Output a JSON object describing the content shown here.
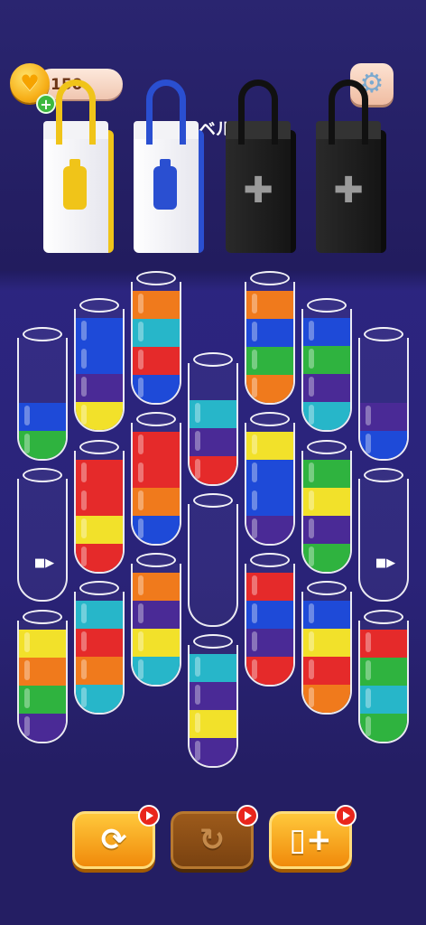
{
  "header": {
    "coins": "150",
    "level_label": "レベル4"
  },
  "bags": [
    {
      "color": "#f0c419",
      "state": "open"
    },
    {
      "color": "#2a4fd1",
      "state": "open"
    },
    {
      "color": "#1a1a1a",
      "state": "locked"
    },
    {
      "color": "#1a1a1a",
      "state": "locked"
    }
  ],
  "tubes": [
    {
      "layers": [
        "#2fb33f",
        "#1e4ad8"
      ]
    },
    {
      "layers": [
        "#f2e12a",
        "#4a2a96",
        "#1e4ad8",
        "#1e4ad8"
      ]
    },
    {
      "layers": [
        "#1e4ad8",
        "#e52a2a",
        "#27b6c9",
        "#f07a1c"
      ]
    },
    {
      "layers": [
        "#e52a2a",
        "#4a2a96",
        "#27b6c9"
      ]
    },
    {
      "layers": [
        "#f07a1c",
        "#2fb33f",
        "#1e4ad8",
        "#f07a1c"
      ]
    },
    {
      "layers": [
        "#27b6c9",
        "#4a2a96",
        "#2fb33f",
        "#1e4ad8"
      ]
    },
    {
      "layers": [
        "#1e4ad8",
        "#4a2a96"
      ]
    },
    {
      "layers": []
    },
    {
      "layers": [
        "#e52a2a",
        "#f2e12a",
        "#e52a2a",
        "#e52a2a"
      ]
    },
    {
      "layers": [
        "#1e4ad8",
        "#f07a1c",
        "#e52a2a",
        "#e52a2a"
      ]
    },
    {
      "layers": []
    },
    {
      "layers": [
        "#4a2a96",
        "#1e4ad8",
        "#1e4ad8",
        "#f2e12a"
      ]
    },
    {
      "layers": [
        "#2fb33f",
        "#4a2a96",
        "#f2e12a",
        "#2fb33f"
      ]
    },
    {
      "layers": []
    },
    {
      "layers": [
        "#4a2a96",
        "#2fb33f",
        "#f07a1c",
        "#f2e12a"
      ]
    },
    {
      "layers": [
        "#27b6c9",
        "#f07a1c",
        "#e52a2a",
        "#27b6c9"
      ]
    },
    {
      "layers": [
        "#27b6c9",
        "#f2e12a",
        "#4a2a96",
        "#f07a1c"
      ]
    },
    {
      "layers": [
        "#4a2a96",
        "#f2e12a",
        "#4a2a96",
        "#27b6c9"
      ]
    },
    {
      "layers": [
        "#e52a2a",
        "#4a2a96",
        "#1e4ad8",
        "#e52a2a"
      ]
    },
    {
      "layers": [
        "#f07a1c",
        "#e52a2a",
        "#f2e12a",
        "#1e4ad8"
      ]
    },
    {
      "layers": [
        "#2fb33f",
        "#27b6c9",
        "#2fb33f",
        "#e52a2a"
      ]
    }
  ],
  "empty_tube_icon": "video-camera-icon",
  "buttons": [
    {
      "name": "shuffle",
      "icon": "shuffle-icon"
    },
    {
      "name": "undo",
      "icon": "undo-icon"
    },
    {
      "name": "add-tube",
      "icon": "add-bottle-icon"
    }
  ],
  "colors": {
    "background": "#241e63",
    "accent": "#f5a623"
  }
}
